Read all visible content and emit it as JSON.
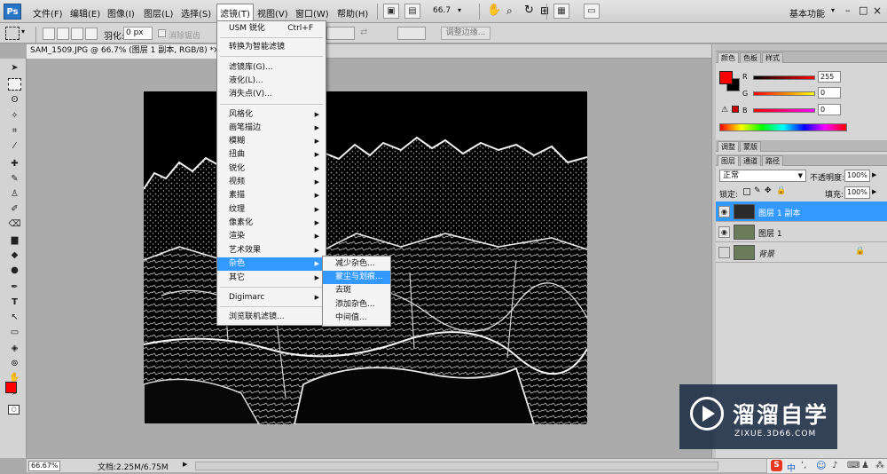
{
  "app": {
    "logo": "Ps",
    "workspace": "基本功能"
  },
  "menubar": {
    "items": [
      "文件(F)",
      "编辑(E)",
      "图像(I)",
      "图层(L)",
      "选择(S)",
      "滤镜(T)",
      "视图(V)",
      "窗口(W)",
      "帮助(H)"
    ],
    "zoom": "66.7",
    "window_controls": [
      "–",
      "□",
      "×"
    ]
  },
  "options": {
    "feather_label": "羽化:",
    "feather_value": "0 px",
    "antialias_label": "消除锯齿",
    "refine_button": "调整边缘..."
  },
  "document": {
    "tab_title": "SAM_1509.JPG @ 66.7% (图层 1 副本, RGB/8) *",
    "zoom": "66.67%",
    "doc_info": "文档:2.25M/6.75M"
  },
  "filter_menu": {
    "top_items": [
      {
        "label": "USM 锐化",
        "shortcut": "Ctrl+F"
      },
      {
        "label": "转换为智能滤镜"
      },
      {
        "label": "滤镜库(G)..."
      },
      {
        "label": "液化(L)..."
      },
      {
        "label": "消失点(V)..."
      }
    ],
    "categories": [
      "风格化",
      "画笔描边",
      "模糊",
      "扭曲",
      "锐化",
      "视频",
      "素描",
      "纹理",
      "像素化",
      "渲染",
      "艺术效果",
      "杂色",
      "其它"
    ],
    "selected_category": "杂色",
    "digimarc": "Digimarc",
    "browse": "浏览联机滤镜..."
  },
  "noise_submenu": {
    "items": [
      "减少杂色...",
      "蒙尘与划痕...",
      "去斑",
      "添加杂色...",
      "中间值..."
    ],
    "selected": "蒙尘与划痕..."
  },
  "color_panel": {
    "tabs": [
      "颜色",
      "色板",
      "样式"
    ],
    "r_label": "R",
    "g_label": "G",
    "b_label": "B",
    "r": "255",
    "g": "0",
    "b": "0",
    "foreground": "#ff0000",
    "background": "#000000"
  },
  "adjust_panel": {
    "tabs": [
      "调整",
      "蒙版"
    ]
  },
  "layers_panel": {
    "tabs": [
      "图层",
      "通道",
      "路径"
    ],
    "blend_mode": "正常",
    "opacity_label": "不透明度:",
    "opacity": "100%",
    "lock_label": "锁定:",
    "fill_label": "填充:",
    "fill": "100%",
    "layers": [
      {
        "name": "图层 1 副本",
        "selected": true,
        "visible": true
      },
      {
        "name": "图层 1",
        "selected": false,
        "visible": true
      },
      {
        "name": "背景",
        "selected": false,
        "visible": false,
        "locked": true
      }
    ]
  },
  "watermark": {
    "brand": "溜溜自学",
    "url": "ZIXUE.3D66.COM"
  },
  "taskbar_tray": [
    "S",
    "中",
    "♪"
  ],
  "accent": "#3399ff"
}
